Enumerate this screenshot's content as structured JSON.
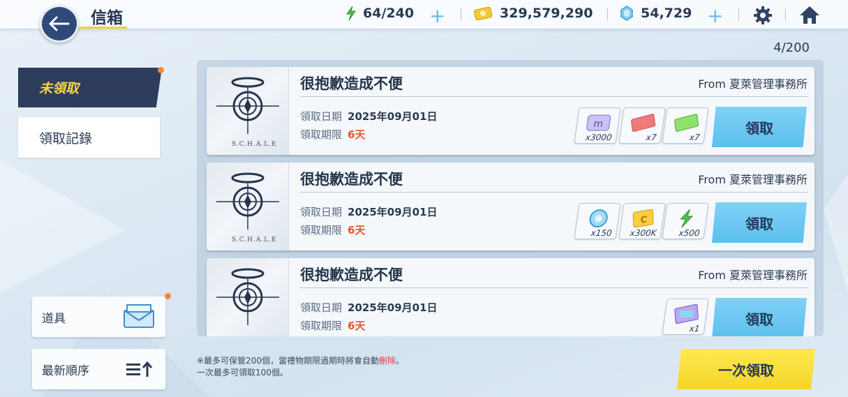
{
  "header": {
    "title": "信箱",
    "ap": "64/240",
    "credits": "329,579,290",
    "gems": "54,729"
  },
  "mail_count": "4/200",
  "tabs": {
    "unclaimed": "未領取",
    "history": "領取記錄"
  },
  "side": {
    "items_label": "道具",
    "sort_label": "最新順序"
  },
  "mails": [
    {
      "title": "很抱歉造成不便",
      "from": "From 夏萊管理事務所",
      "date_label": "領取日期",
      "date": "2025年09月01日",
      "limit_label": "領取期限",
      "limit": "6天",
      "logo": "S.C.H.A.L.E",
      "rewards": [
        {
          "icon": "eligma-icon",
          "qty": "x3000"
        },
        {
          "icon": "ticket-red-icon",
          "qty": "x7"
        },
        {
          "icon": "ticket-green-icon",
          "qty": "x7"
        }
      ],
      "claim": "領取"
    },
    {
      "title": "很抱歉造成不便",
      "from": "From 夏萊管理事務所",
      "date_label": "領取日期",
      "date": "2025年09月01日",
      "limit_label": "領取期限",
      "limit": "6天",
      "logo": "S.C.H.A.L.E",
      "rewards": [
        {
          "icon": "pyroxene-icon",
          "qty": "x150"
        },
        {
          "icon": "credit-icon",
          "qty": "x300K"
        },
        {
          "icon": "ap-icon",
          "qty": "x500"
        }
      ],
      "claim": "領取"
    },
    {
      "title": "很抱歉造成不便",
      "from": "From 夏萊管理事務所",
      "date_label": "領取日期",
      "date": "2025年09月01日",
      "limit_label": "領取期限",
      "limit": "6天",
      "logo": "",
      "rewards": [
        {
          "icon": "card-pack-icon",
          "qty": "x1"
        }
      ],
      "claim": "領取"
    }
  ],
  "note": {
    "line1_prefix": "※最多可保管200個，當禮物期限過期時將會自動",
    "line1_red": "刪除",
    "line1_suffix": "。",
    "line2": "一次最多可領取100個。"
  },
  "claim_all": "一次領取",
  "colors": {
    "accent_yellow": "#f6d52b",
    "claim_blue": "#5cbfee",
    "dark_navy": "#2e3d5b",
    "limit_red": "#e8562a"
  }
}
